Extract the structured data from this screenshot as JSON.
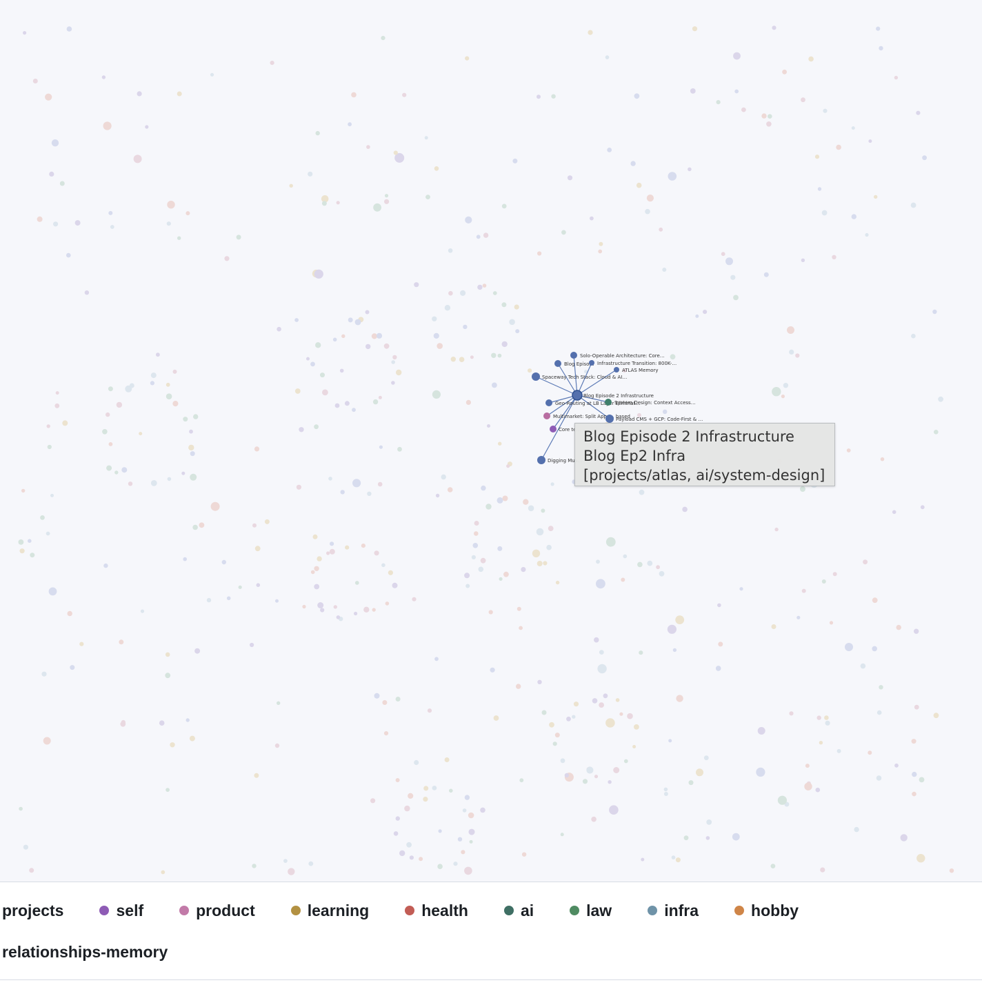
{
  "graph": {
    "focus_node": {
      "label": "Blog Episode 2 Infrastructure",
      "color": "#5470ad"
    },
    "neighbor_nodes": [
      {
        "label": "Solo-Operable Architecture: Core…",
        "color": "#5470ad"
      },
      {
        "label": "Blog Episo…",
        "color": "#5470ad"
      },
      {
        "label": "Infrastructure Transition: 800K-…",
        "color": "#5470ad"
      },
      {
        "label": "ATLAS Memory",
        "color": "#5470ad"
      },
      {
        "label": "Spaceway Tech Stack: Cloud & AI…",
        "color": "#5470ad"
      },
      {
        "label": "Geo-Routing at LB Layer Eliminat…",
        "color": "#5470ad"
      },
      {
        "label": "System Design: Context Access…",
        "color": "#3f7f6b"
      },
      {
        "label": "Multimarket: Split Apps… based",
        "color": "#b86da1"
      },
      {
        "label": "Payload CMS + GCP: Code-First & …",
        "color": "#5470ad"
      },
      {
        "label": "Core te…",
        "color": "#8e5bb5"
      },
      {
        "label": "Digging Mus…",
        "color": "#5470ad"
      }
    ],
    "edge_color": "#5b79b5"
  },
  "tooltip": {
    "line1": "Blog Episode 2 Infrastructure",
    "line2": "Blog Ep2 Infra",
    "line3": "[projects/atlas, ai/system-design]"
  },
  "legend": {
    "items": [
      {
        "label": "projects",
        "color": "#5470ad"
      },
      {
        "label": "self",
        "color": "#8e5bb5"
      },
      {
        "label": "product",
        "color": "#c27aa8"
      },
      {
        "label": "learning",
        "color": "#b39142"
      },
      {
        "label": "health",
        "color": "#c25d55"
      },
      {
        "label": "ai",
        "color": "#3f6f64"
      },
      {
        "label": "law",
        "color": "#4f8b62"
      },
      {
        "label": "infra",
        "color": "#6f93a8"
      },
      {
        "label": "hobby",
        "color": "#cf8548"
      },
      {
        "label": "relationships-memory",
        "color": ""
      }
    ]
  }
}
